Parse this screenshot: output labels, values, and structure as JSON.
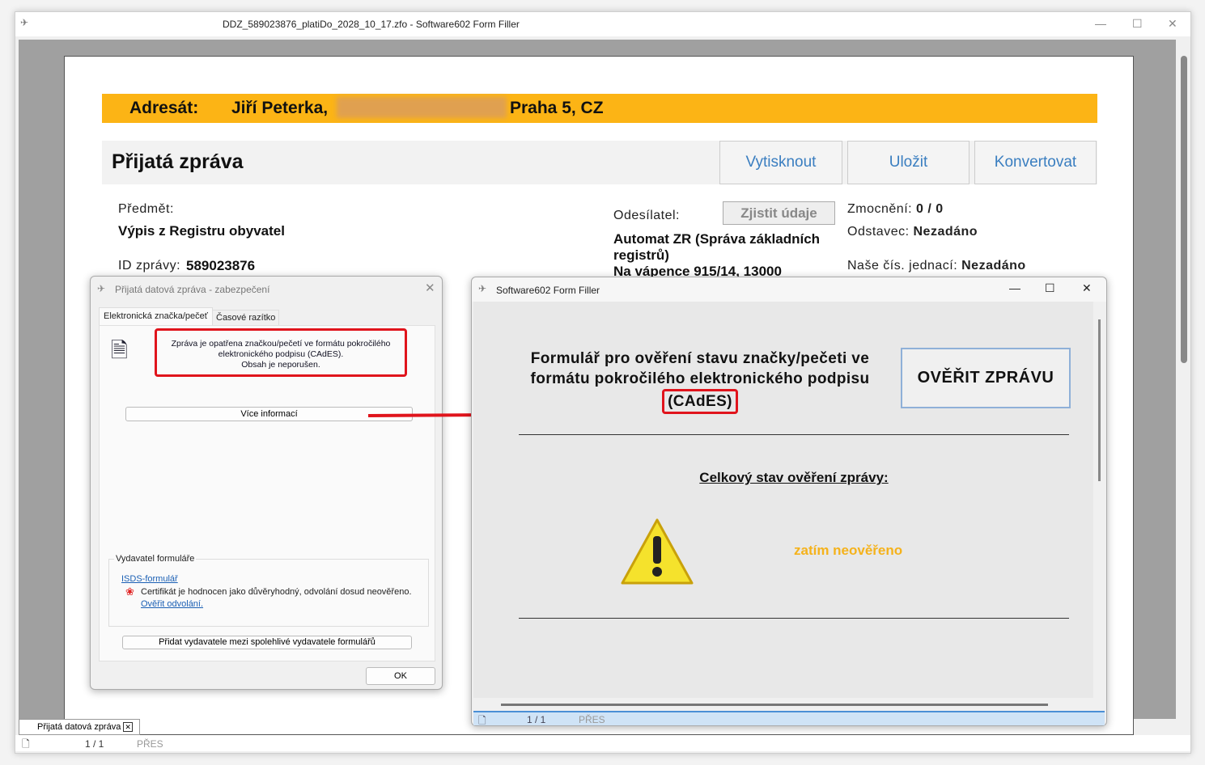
{
  "window": {
    "title": "DDZ_589023876_platiDo_2028_10_17.zfo - Software602 Form Filler"
  },
  "form": {
    "addressee_label": "Adresát:",
    "addressee_name": "Jiří Peterka,",
    "addressee_city": "Praha 5, CZ",
    "title": "Přijatá zpráva",
    "print": "Vytisknout",
    "save": "Uložit",
    "convert": "Konvertovat",
    "subject_label": "Předmět:",
    "subject": "Výpis z Registru obyvatel",
    "id_label": "ID zprávy:",
    "id": "589023876",
    "sender_label": "Odesílatel:",
    "find_details": "Zjistit údaje",
    "sender_line1": "Automat ZR (Správa základních",
    "sender_line2": "registrů)",
    "sender_line3": "Na vápence 915/14, 13000",
    "auth_label": "Zmocnění:",
    "auth": "0 / 0",
    "para_label": "Odstavec:",
    "para": "Nezadáno",
    "ref_label": "Naše čís. jednací:",
    "ref": "Nezadáno"
  },
  "tab": {
    "label": "Přijatá datová zpráva"
  },
  "status": {
    "pages": "1 / 1",
    "mode": "PŘES"
  },
  "security_dialog": {
    "title": "Přijatá datová zpráva - zabezpečení",
    "tabs": [
      "Elektronická značka/pečeť",
      "Časové razítko"
    ],
    "msg1": "Zpráva je opatřena značkou/pečetí ve formátu pokročilého",
    "msg2": "elektronického podpisu (CAdES).",
    "msg3": "Obsah je neporušen.",
    "more": "Více informací",
    "issuer_group": "Vydavatel formuláře",
    "issuer_link": "ISDS-formulář",
    "cert_text": "Certifikát je hodnocen jako důvěryhodný, odvolání dosud neověřeno.",
    "verify_link": "Ověřit odvolání.",
    "add_issuer": "Přidat vydavatele mezi spolehlivé vydavatele formulářů",
    "ok": "OK"
  },
  "filler_dialog": {
    "title": "Software602 Form Filler",
    "heading1": "Formulář pro ověření stavu značky/pečeti ve",
    "heading2": "formátu pokročilého elektronického podpisu",
    "heading3": "(CAdES)",
    "verify": "OVĚŘIT ZPRÁVU",
    "overall": "Celkový stav ověření zprávy:",
    "state": "zatím neověřeno",
    "pages": "1 / 1",
    "mode": "PŘES"
  },
  "colors": {
    "accent": "#fcb415",
    "highlight": "#e0141c",
    "link": "#3a7ec0",
    "state": "#f5b21b"
  }
}
